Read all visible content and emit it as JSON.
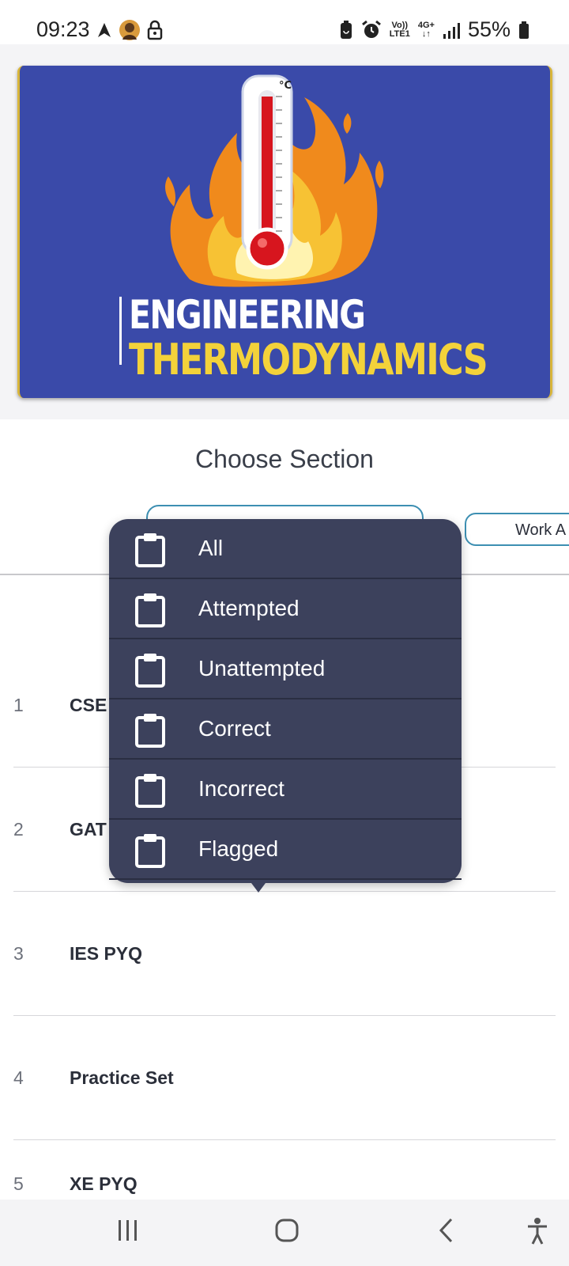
{
  "status_bar": {
    "time": "09:23",
    "battery_percent": "55%",
    "net_top": "Vo))",
    "net_bottom": "LTE1",
    "net_gen_top": "4G+",
    "net_gen_bottom": "↓↑",
    "icons": [
      "navigation-icon",
      "avatar",
      "lock-icon",
      "battery-saver-icon",
      "alarm-icon",
      "signal-icon",
      "battery-icon"
    ]
  },
  "banner": {
    "line1": "ENGINEERING",
    "line2": "THERMODYNAMICS",
    "thermometer_unit": "°C",
    "colors": {
      "background": "#3a4aa9",
      "accent": "#f3d23a"
    }
  },
  "section": {
    "title": "Choose Section",
    "tab_visible_label": "Work A"
  },
  "list": {
    "rows": [
      {
        "num": "1",
        "title": "CSE"
      },
      {
        "num": "2",
        "title": "GAT"
      },
      {
        "num": "3",
        "title": "IES PYQ"
      },
      {
        "num": "4",
        "title": "Practice Set"
      },
      {
        "num": "5",
        "title": "XE PYQ"
      }
    ]
  },
  "dropdown": {
    "items": [
      {
        "label": "All",
        "icon": "clipboard-icon"
      },
      {
        "label": "Attempted",
        "icon": "clipboard-icon"
      },
      {
        "label": "Unattempted",
        "icon": "clipboard-icon"
      },
      {
        "label": "Correct",
        "icon": "clipboard-icon"
      },
      {
        "label": "Incorrect",
        "icon": "clipboard-icon"
      },
      {
        "label": "Flagged",
        "icon": "clipboard-icon"
      }
    ]
  },
  "nav_bar": {
    "buttons": [
      "recent-apps-icon",
      "home-icon",
      "back-icon",
      "accessibility-icon"
    ]
  }
}
